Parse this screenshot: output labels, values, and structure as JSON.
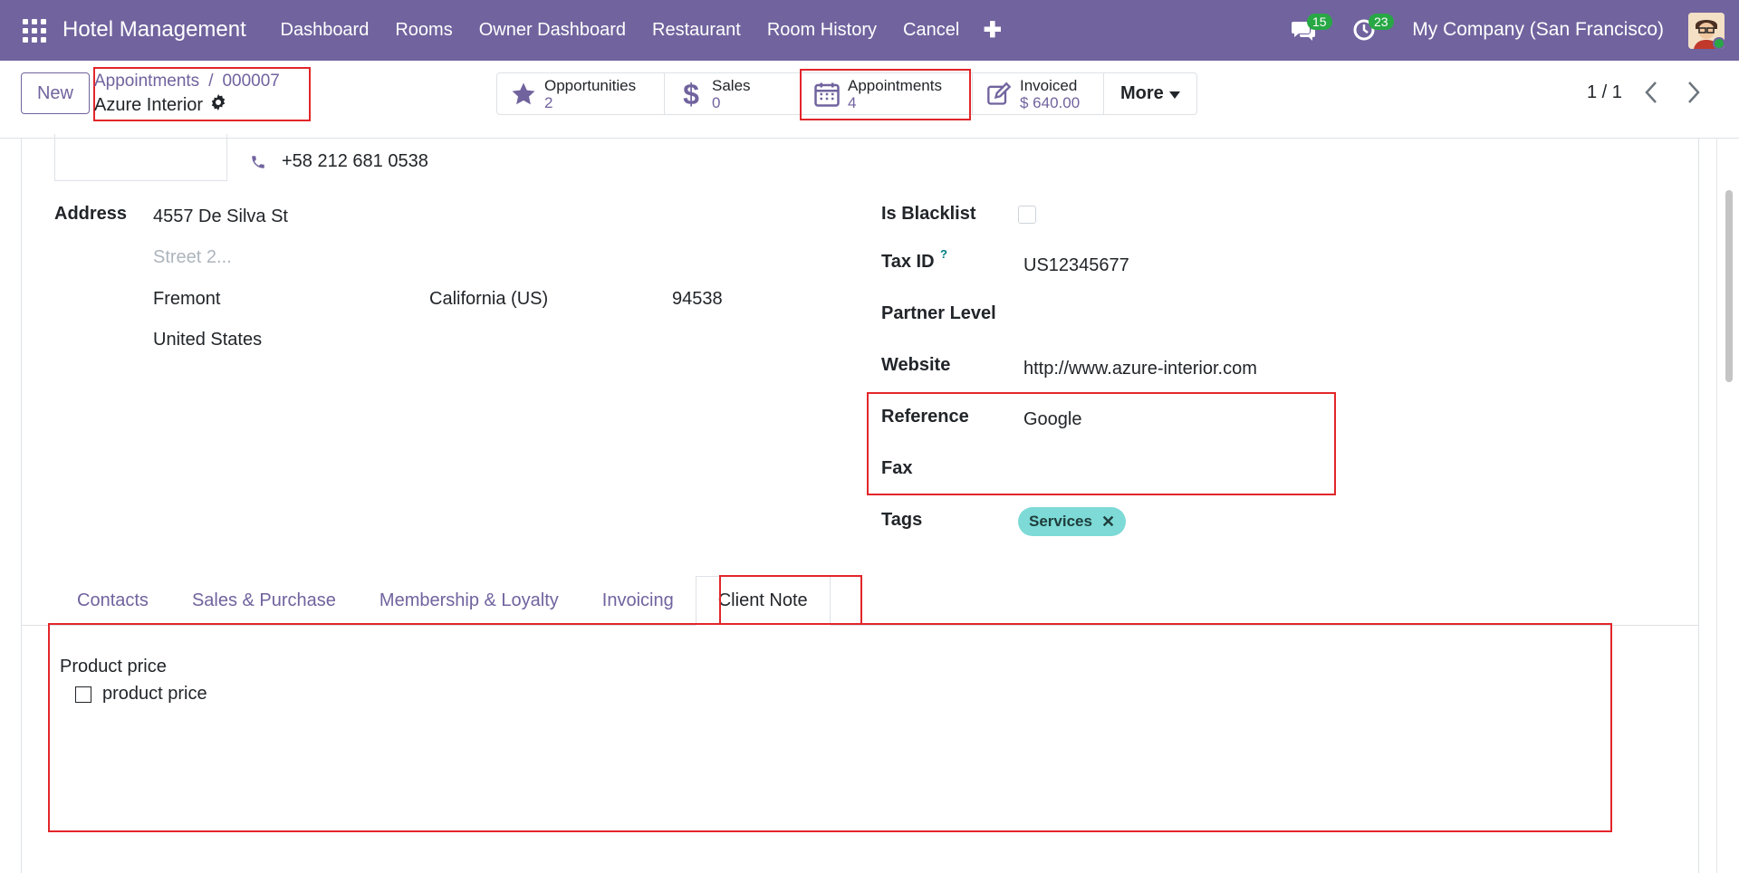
{
  "navbar": {
    "brand": "Hotel Management",
    "menu": [
      "Dashboard",
      "Rooms",
      "Owner Dashboard",
      "Restaurant",
      "Room History",
      "Cancel"
    ],
    "plus": "✚",
    "messages_count": "15",
    "activities_count": "23",
    "company": "My Company (San Francisco)"
  },
  "control_panel": {
    "new_label": "New",
    "breadcrumb_parent": "Appointments",
    "breadcrumb_sep": "/",
    "breadcrumb_current": "000007",
    "record_name": "Azure Interior",
    "stat_buttons": [
      {
        "label": "Opportunities",
        "value": "2",
        "icon": "star-icon"
      },
      {
        "label": "Sales",
        "value": "0",
        "icon": "dollar-icon"
      },
      {
        "label": "Appointments",
        "value": "4",
        "icon": "calendar-icon"
      },
      {
        "label": "Invoiced",
        "value": "$ 640.00",
        "icon": "edit-icon"
      }
    ],
    "more_label": "More",
    "pager": "1 / 1"
  },
  "form": {
    "phone": "+58 212 681 0538",
    "address_label": "Address",
    "street": "4557 De Silva St",
    "street2_placeholder": "Street 2...",
    "city": "Fremont",
    "state": "California (US)",
    "zip": "94538",
    "country": "United States",
    "is_blacklist_label": "Is Blacklist",
    "tax_id_label": "Tax ID",
    "tax_id_help": "?",
    "tax_id": "US12345677",
    "partner_level_label": "Partner Level",
    "website_label": "Website",
    "website": "http://www.azure-interior.com",
    "reference_label": "Reference",
    "reference": "Google",
    "fax_label": "Fax",
    "tags_label": "Tags",
    "tag": "Services",
    "tag_remove": "✕"
  },
  "tabs": [
    "Contacts",
    "Sales & Purchase",
    "Membership & Loyalty",
    "Invoicing",
    "Client Note"
  ],
  "active_tab": "Client Note",
  "client_note": {
    "heading": "Product price",
    "checklist_item": "product price"
  },
  "colors": {
    "brand": "#71639e",
    "highlight": "#e2262a",
    "tag": "#7ddad6",
    "badge": "#28a745"
  }
}
